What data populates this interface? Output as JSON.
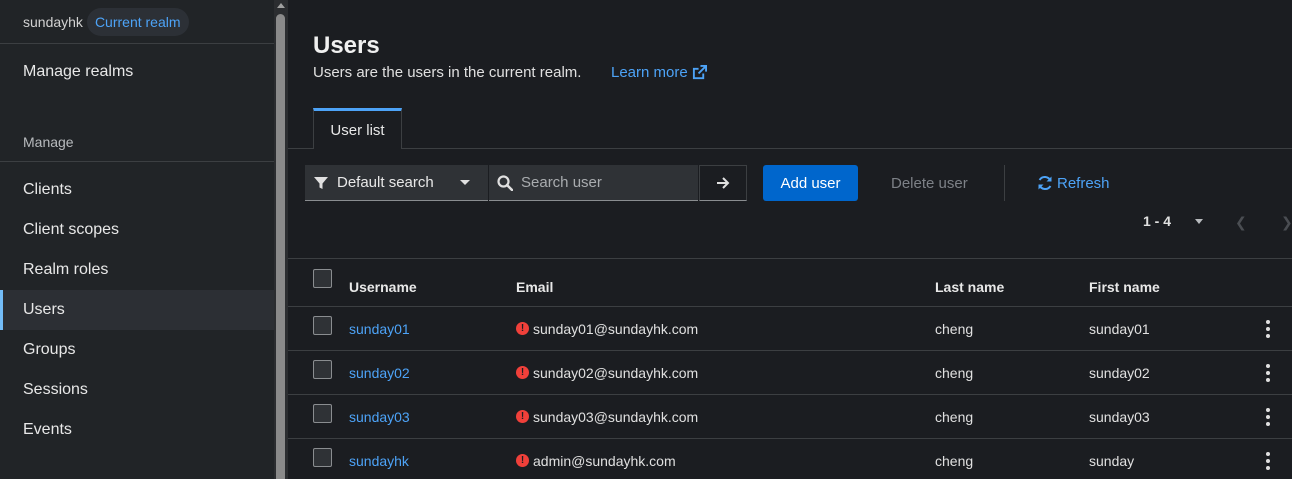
{
  "realm": {
    "name": "sundayhk",
    "badge": "Current realm"
  },
  "sidebar": {
    "manage_realms": "Manage realms",
    "section_title": "Manage",
    "items": [
      {
        "label": "Clients",
        "active": false
      },
      {
        "label": "Client scopes",
        "active": false
      },
      {
        "label": "Realm roles",
        "active": false
      },
      {
        "label": "Users",
        "active": true
      },
      {
        "label": "Groups",
        "active": false
      },
      {
        "label": "Sessions",
        "active": false
      },
      {
        "label": "Events",
        "active": false
      }
    ]
  },
  "page": {
    "title": "Users",
    "description": "Users are the users in the current realm.",
    "learn_more": "Learn more"
  },
  "tabs": [
    {
      "label": "User list",
      "active": true
    }
  ],
  "toolbar": {
    "filter_label": "Default search",
    "search_placeholder": "Search user",
    "add_user": "Add user",
    "delete_user": "Delete user",
    "refresh": "Refresh"
  },
  "pagination": {
    "range": "1 - 4"
  },
  "table": {
    "columns": [
      "Username",
      "Email",
      "Last name",
      "First name"
    ],
    "rows": [
      {
        "username": "sunday01",
        "email": "sunday01@sundayhk.com",
        "last_name": "cheng",
        "first_name": "sunday01"
      },
      {
        "username": "sunday02",
        "email": "sunday02@sundayhk.com",
        "last_name": "cheng",
        "first_name": "sunday02"
      },
      {
        "username": "sunday03",
        "email": "sunday03@sundayhk.com",
        "last_name": "cheng",
        "first_name": "sunday03"
      },
      {
        "username": "sundayhk",
        "email": "admin@sundayhk.com",
        "last_name": "cheng",
        "first_name": "sunday"
      }
    ]
  },
  "colors": {
    "accent": "#4da3f7",
    "primary_button": "#0066cc",
    "warning": "#f0403a",
    "background": "#1b1d21",
    "sidebar": "#212427"
  }
}
